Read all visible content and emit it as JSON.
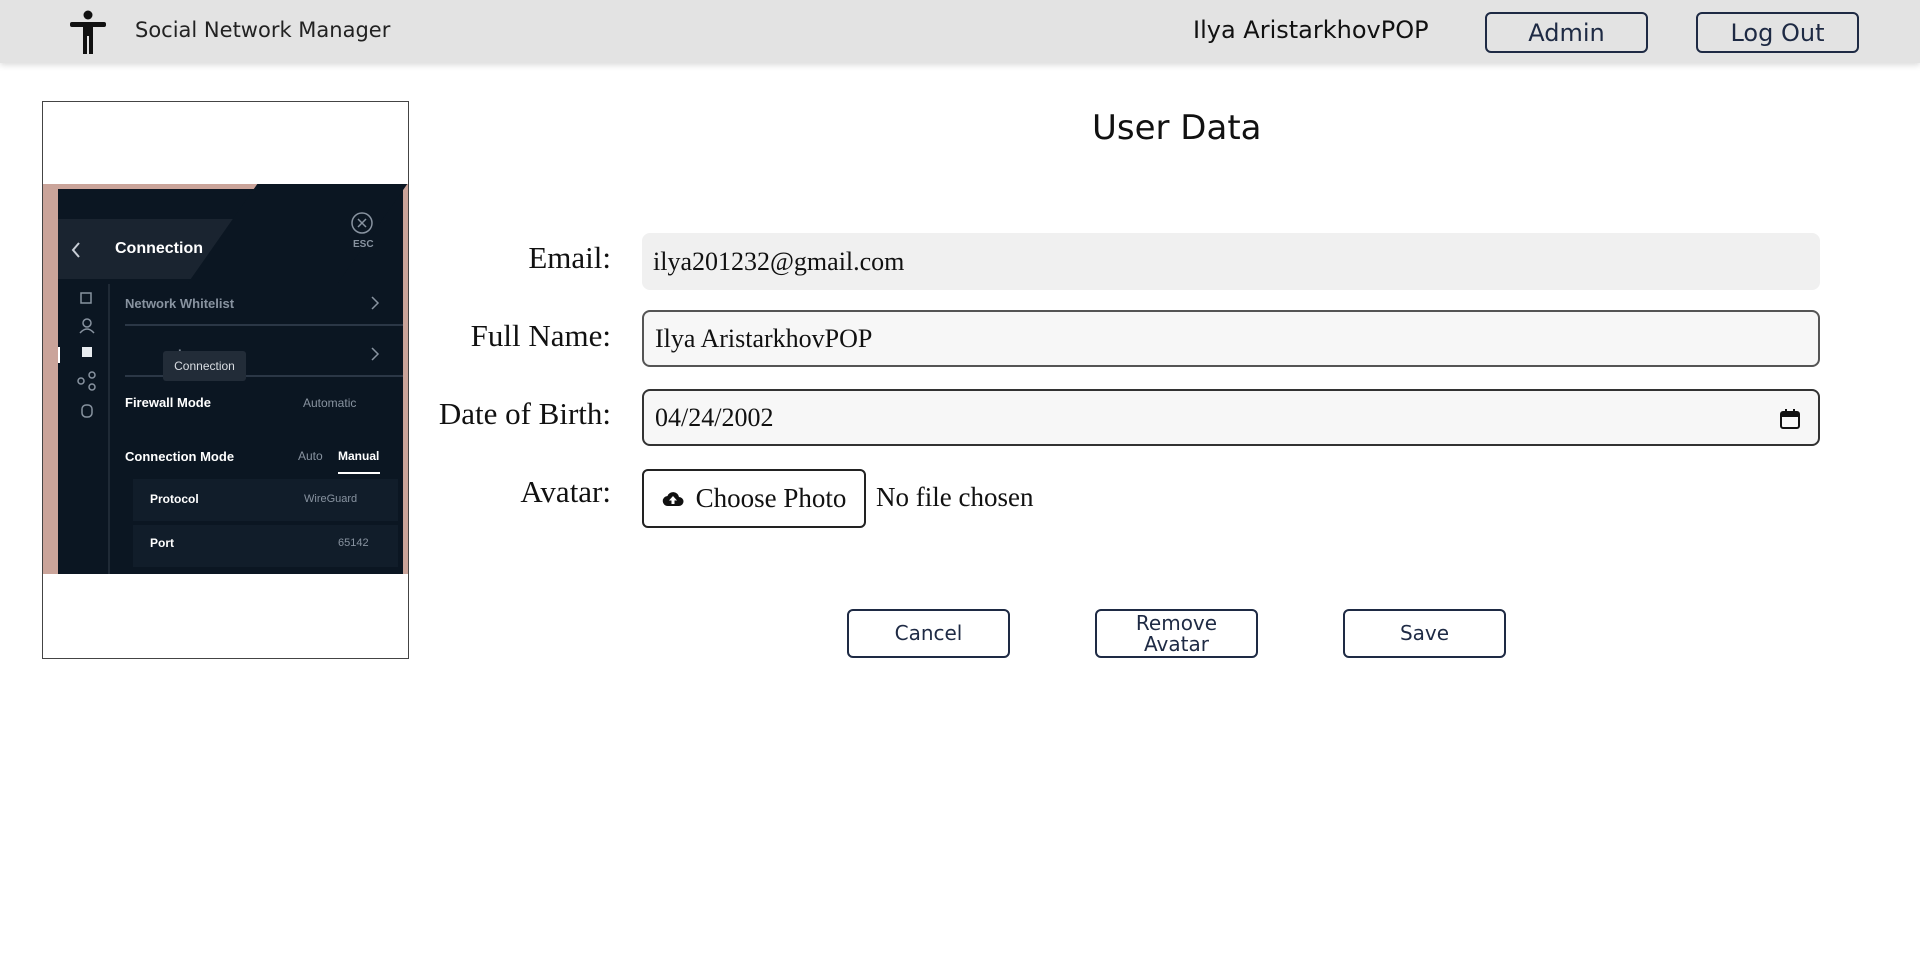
{
  "header": {
    "app_title": "Social Network Manager",
    "user_name": "Ilya AristarkhovPOP",
    "admin_label": "Admin",
    "logout_label": "Log Out"
  },
  "avatar_preview": {
    "panel_title": "Connection",
    "esc_label": "ESC",
    "items": {
      "network_whitelist": "Network Whitelist",
      "partial_settings": "ings",
      "firewall_mode": "Firewall Mode",
      "firewall_mode_value": "Automatic",
      "connection_mode": "Connection Mode",
      "mode_auto": "Auto",
      "mode_manual": "Manual",
      "protocol": "Protocol",
      "protocol_value": "WireGuard",
      "port": "Port",
      "port_value": "65142"
    },
    "tooltip": "Connection"
  },
  "form": {
    "title": "User Data",
    "email_label": "Email:",
    "email_value": "ilya201232@gmail.com",
    "fullname_label": "Full Name:",
    "fullname_value": "Ilya AristarkhovPOP",
    "dob_label": "Date of Birth:",
    "dob_value": "04/24/2002",
    "avatar_label": "Avatar:",
    "choose_photo_label": "Choose Photo",
    "no_file_text": "No file chosen"
  },
  "actions": {
    "cancel_label": "Cancel",
    "remove_avatar_label": "Remove Avatar",
    "save_label": "Save"
  }
}
